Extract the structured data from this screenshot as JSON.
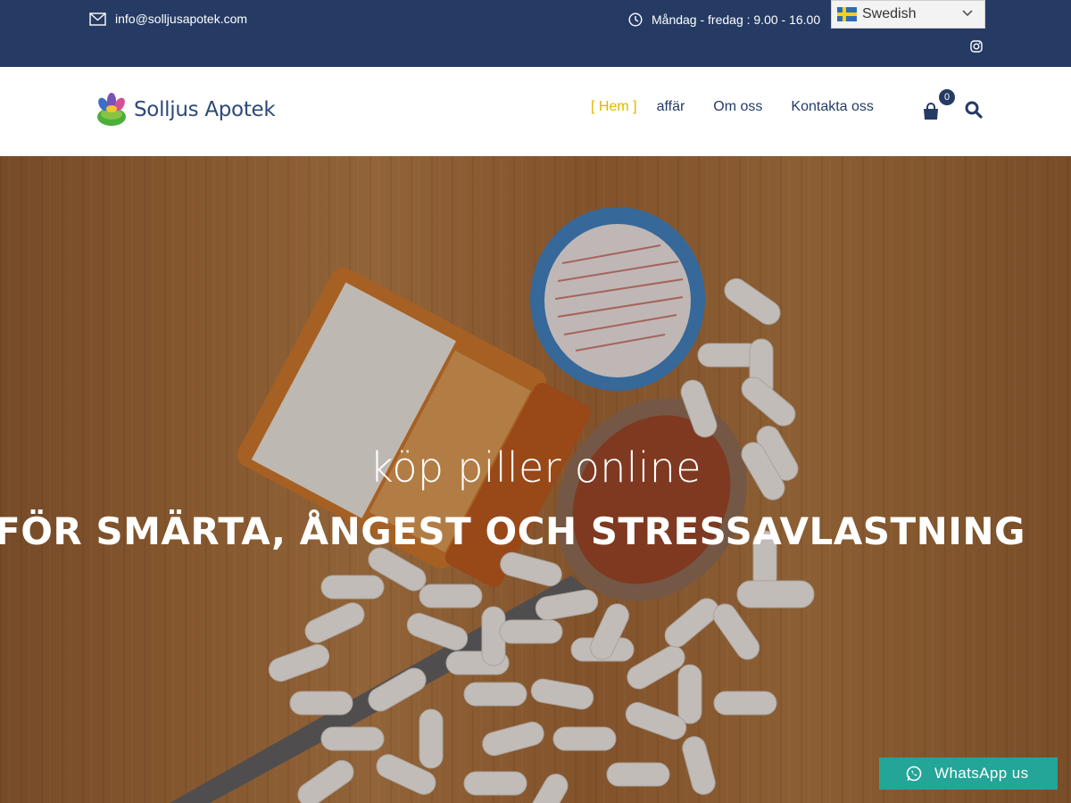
{
  "topbar": {
    "email": "info@solljusapotek.com",
    "hours": "Måndag - fredag : 9.00 - 16.00",
    "language": "Swedish"
  },
  "header": {
    "logo_text": "Solljus Apotek",
    "nav": {
      "home": "Hem",
      "shop": "affär",
      "about": "Om oss",
      "contact": "Kontakta oss"
    },
    "cart_count": "0"
  },
  "hero": {
    "subtitle": "köp piller online",
    "title": "FÖR SMÄRTA, ÅNGEST OCH STRESSAVLASTNING"
  },
  "whatsapp": {
    "label": "WhatsApp us"
  },
  "colors": {
    "topbar": "#253b64",
    "accent": "#e1b500",
    "whatsapp": "#23a597"
  }
}
